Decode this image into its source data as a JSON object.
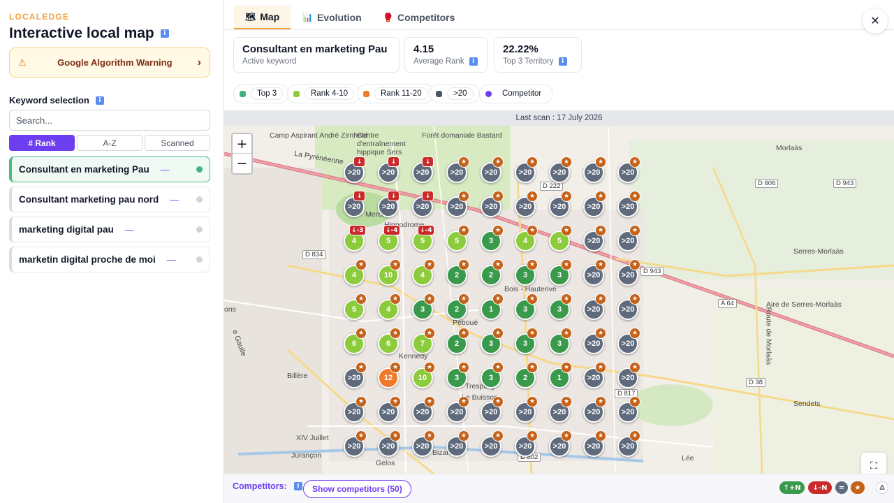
{
  "sidebar": {
    "brand": "LOCALEDGE",
    "title": "Interactive local map",
    "warning_label": "Google Algorithm Warning",
    "keyword_section_label": "Keyword selection",
    "search_placeholder": "Search...",
    "sort_options": [
      "# Rank",
      "A-Z",
      "Scanned"
    ],
    "keywords": [
      {
        "label": "Consultant en marketing Pau",
        "trend": "—",
        "active": true
      },
      {
        "label": "Consultant marketing pau nord",
        "trend": "—",
        "active": false
      },
      {
        "label": "marketing digital pau",
        "trend": "—",
        "active": false
      },
      {
        "label": "marketin digital proche de moi",
        "trend": "—",
        "active": false
      }
    ]
  },
  "tabs": [
    {
      "label": "Map",
      "icon": "map-icon",
      "active": true
    },
    {
      "label": "Evolution",
      "icon": "chart-icon",
      "active": false
    },
    {
      "label": "Competitors",
      "icon": "boxing-glove-icon",
      "active": false
    }
  ],
  "stats": {
    "keyword_value": "Consultant en marketing Pau",
    "keyword_label": "Active keyword",
    "avg_rank_value": "4.15",
    "avg_rank_label": "Average Rank",
    "top3_value": "22.22%",
    "top3_label": "Top 3 Territory"
  },
  "legend": [
    {
      "label": "Top 3",
      "color": "#3fb37f"
    },
    {
      "label": "Rank 4-10",
      "color": "#8ccb3c"
    },
    {
      "label": "Rank 11-20",
      "color": "#f07a2a"
    },
    {
      "label": ">20",
      "color": "#4b5563"
    },
    {
      "label": "Competitor",
      "color": "#6d3df0"
    }
  ],
  "last_scan": "Last scan : 17 July 2026",
  "colors": {
    "top3": "#3a9a4c",
    "rank4_10": "#8ccb3c",
    "rank11_20": "#f07a2a",
    "over20": "#5f6b7d",
    "accent": "#6d3df0",
    "star": "#c4621a",
    "down": "#c92a2a"
  },
  "map": {
    "places": [
      "Camp Aspirant André Zirnheld",
      "Centre d'entraînement hippique Sers",
      "Forêt domaniale Bastard",
      "Morlaàs",
      "Serres-Morlaàs",
      "Sendets",
      "Lée",
      "Bois - Hauterive",
      "Billère",
      "XIV Juillet",
      "Jurançon",
      "Gelos",
      "Bizanos",
      "Mercure",
      "Hippodrome",
      "Péboué",
      "Kennedy",
      "Trespoey",
      "Le Buisson",
      "Aire de Serres-Morlaàs",
      "Route de Morlaàs",
      "ons",
      "e Gaulle",
      "La Pyrénéenne"
    ],
    "roads": [
      "D 222",
      "D 606",
      "D 943",
      "D 834",
      "D 943",
      "A 64",
      "D 38",
      "D 817",
      "D 802"
    ],
    "grid": [
      [
        {
          "v": ">20",
          "b": "down"
        },
        {
          "v": ">20",
          "b": "down"
        },
        {
          "v": ">20",
          "b": "down"
        },
        {
          "v": ">20",
          "b": "star"
        },
        {
          "v": ">20",
          "b": "star"
        },
        {
          "v": ">20",
          "b": "star"
        },
        {
          "v": ">20",
          "b": "star"
        },
        {
          "v": ">20",
          "b": "star"
        },
        {
          "v": ">20",
          "b": "star"
        }
      ],
      [
        {
          "v": ">20",
          "b": "down"
        },
        {
          "v": ">20",
          "b": "down"
        },
        {
          "v": ">20",
          "b": "down"
        },
        {
          "v": ">20",
          "b": "star"
        },
        {
          "v": ">20",
          "b": "star"
        },
        {
          "v": ">20",
          "b": "star"
        },
        {
          "v": ">20",
          "b": "star"
        },
        {
          "v": ">20",
          "b": "star"
        },
        {
          "v": ">20",
          "b": "star"
        }
      ],
      [
        {
          "v": "4",
          "b": "down",
          "d": "↓-3"
        },
        {
          "v": "5",
          "b": "down",
          "d": "↓-4"
        },
        {
          "v": "5",
          "b": "down",
          "d": "↓-4"
        },
        {
          "v": "5",
          "b": "star"
        },
        {
          "v": "3",
          "b": "star"
        },
        {
          "v": "4",
          "b": "star"
        },
        {
          "v": "5",
          "b": "star"
        },
        {
          "v": ">20",
          "b": "star"
        },
        {
          "v": ">20",
          "b": "star"
        }
      ],
      [
        {
          "v": "4",
          "b": "star"
        },
        {
          "v": "10",
          "b": "star"
        },
        {
          "v": "4",
          "b": "star"
        },
        {
          "v": "2",
          "b": "star"
        },
        {
          "v": "2",
          "b": "star"
        },
        {
          "v": "3",
          "b": "star"
        },
        {
          "v": "3",
          "b": "star"
        },
        {
          "v": ">20",
          "b": "star"
        },
        {
          "v": ">20",
          "b": "star"
        }
      ],
      [
        {
          "v": "5",
          "b": "star"
        },
        {
          "v": "4",
          "b": "star"
        },
        {
          "v": "3",
          "b": "star"
        },
        {
          "v": "2",
          "b": "star"
        },
        {
          "v": "1",
          "b": "star"
        },
        {
          "v": "3",
          "b": "star"
        },
        {
          "v": "3",
          "b": "star"
        },
        {
          "v": ">20",
          "b": "star"
        },
        {
          "v": ">20",
          "b": "star"
        }
      ],
      [
        {
          "v": "6",
          "b": "star"
        },
        {
          "v": "6",
          "b": "star"
        },
        {
          "v": "7",
          "b": "star"
        },
        {
          "v": "2",
          "b": "star"
        },
        {
          "v": "3",
          "b": "star"
        },
        {
          "v": "3",
          "b": "star"
        },
        {
          "v": "3",
          "b": "star"
        },
        {
          "v": ">20",
          "b": "star"
        },
        {
          "v": ">20",
          "b": "star"
        }
      ],
      [
        {
          "v": ">20",
          "b": "star"
        },
        {
          "v": "12",
          "b": "star"
        },
        {
          "v": "10",
          "b": "star"
        },
        {
          "v": "3",
          "b": "star"
        },
        {
          "v": "3",
          "b": "star"
        },
        {
          "v": "2",
          "b": "star"
        },
        {
          "v": "1",
          "b": "star"
        },
        {
          "v": ">20",
          "b": "star"
        },
        {
          "v": ">20",
          "b": "star"
        }
      ],
      [
        {
          "v": ">20",
          "b": "star"
        },
        {
          "v": ">20",
          "b": "star"
        },
        {
          "v": ">20",
          "b": "star"
        },
        {
          "v": ">20",
          "b": "star"
        },
        {
          "v": ">20",
          "b": "star"
        },
        {
          "v": ">20",
          "b": "star"
        },
        {
          "v": ">20",
          "b": "star"
        },
        {
          "v": ">20",
          "b": "star"
        },
        {
          "v": ">20",
          "b": "star"
        }
      ],
      [
        {
          "v": ">20",
          "b": "star"
        },
        {
          "v": ">20",
          "b": "star"
        },
        {
          "v": ">20",
          "b": "star"
        },
        {
          "v": ">20",
          "b": "star"
        },
        {
          "v": ">20",
          "b": "star"
        },
        {
          "v": ">20",
          "b": "star"
        },
        {
          "v": ">20",
          "b": "star"
        },
        {
          "v": ">20",
          "b": "star"
        },
        {
          "v": ">20",
          "b": "star"
        }
      ]
    ]
  },
  "bottom": {
    "competitors_label": "Competitors:",
    "show_competitors_label": "Show competitors (50)",
    "chips": [
      "↑+N",
      "↓-N",
      "=",
      "★",
      "Δ"
    ]
  }
}
